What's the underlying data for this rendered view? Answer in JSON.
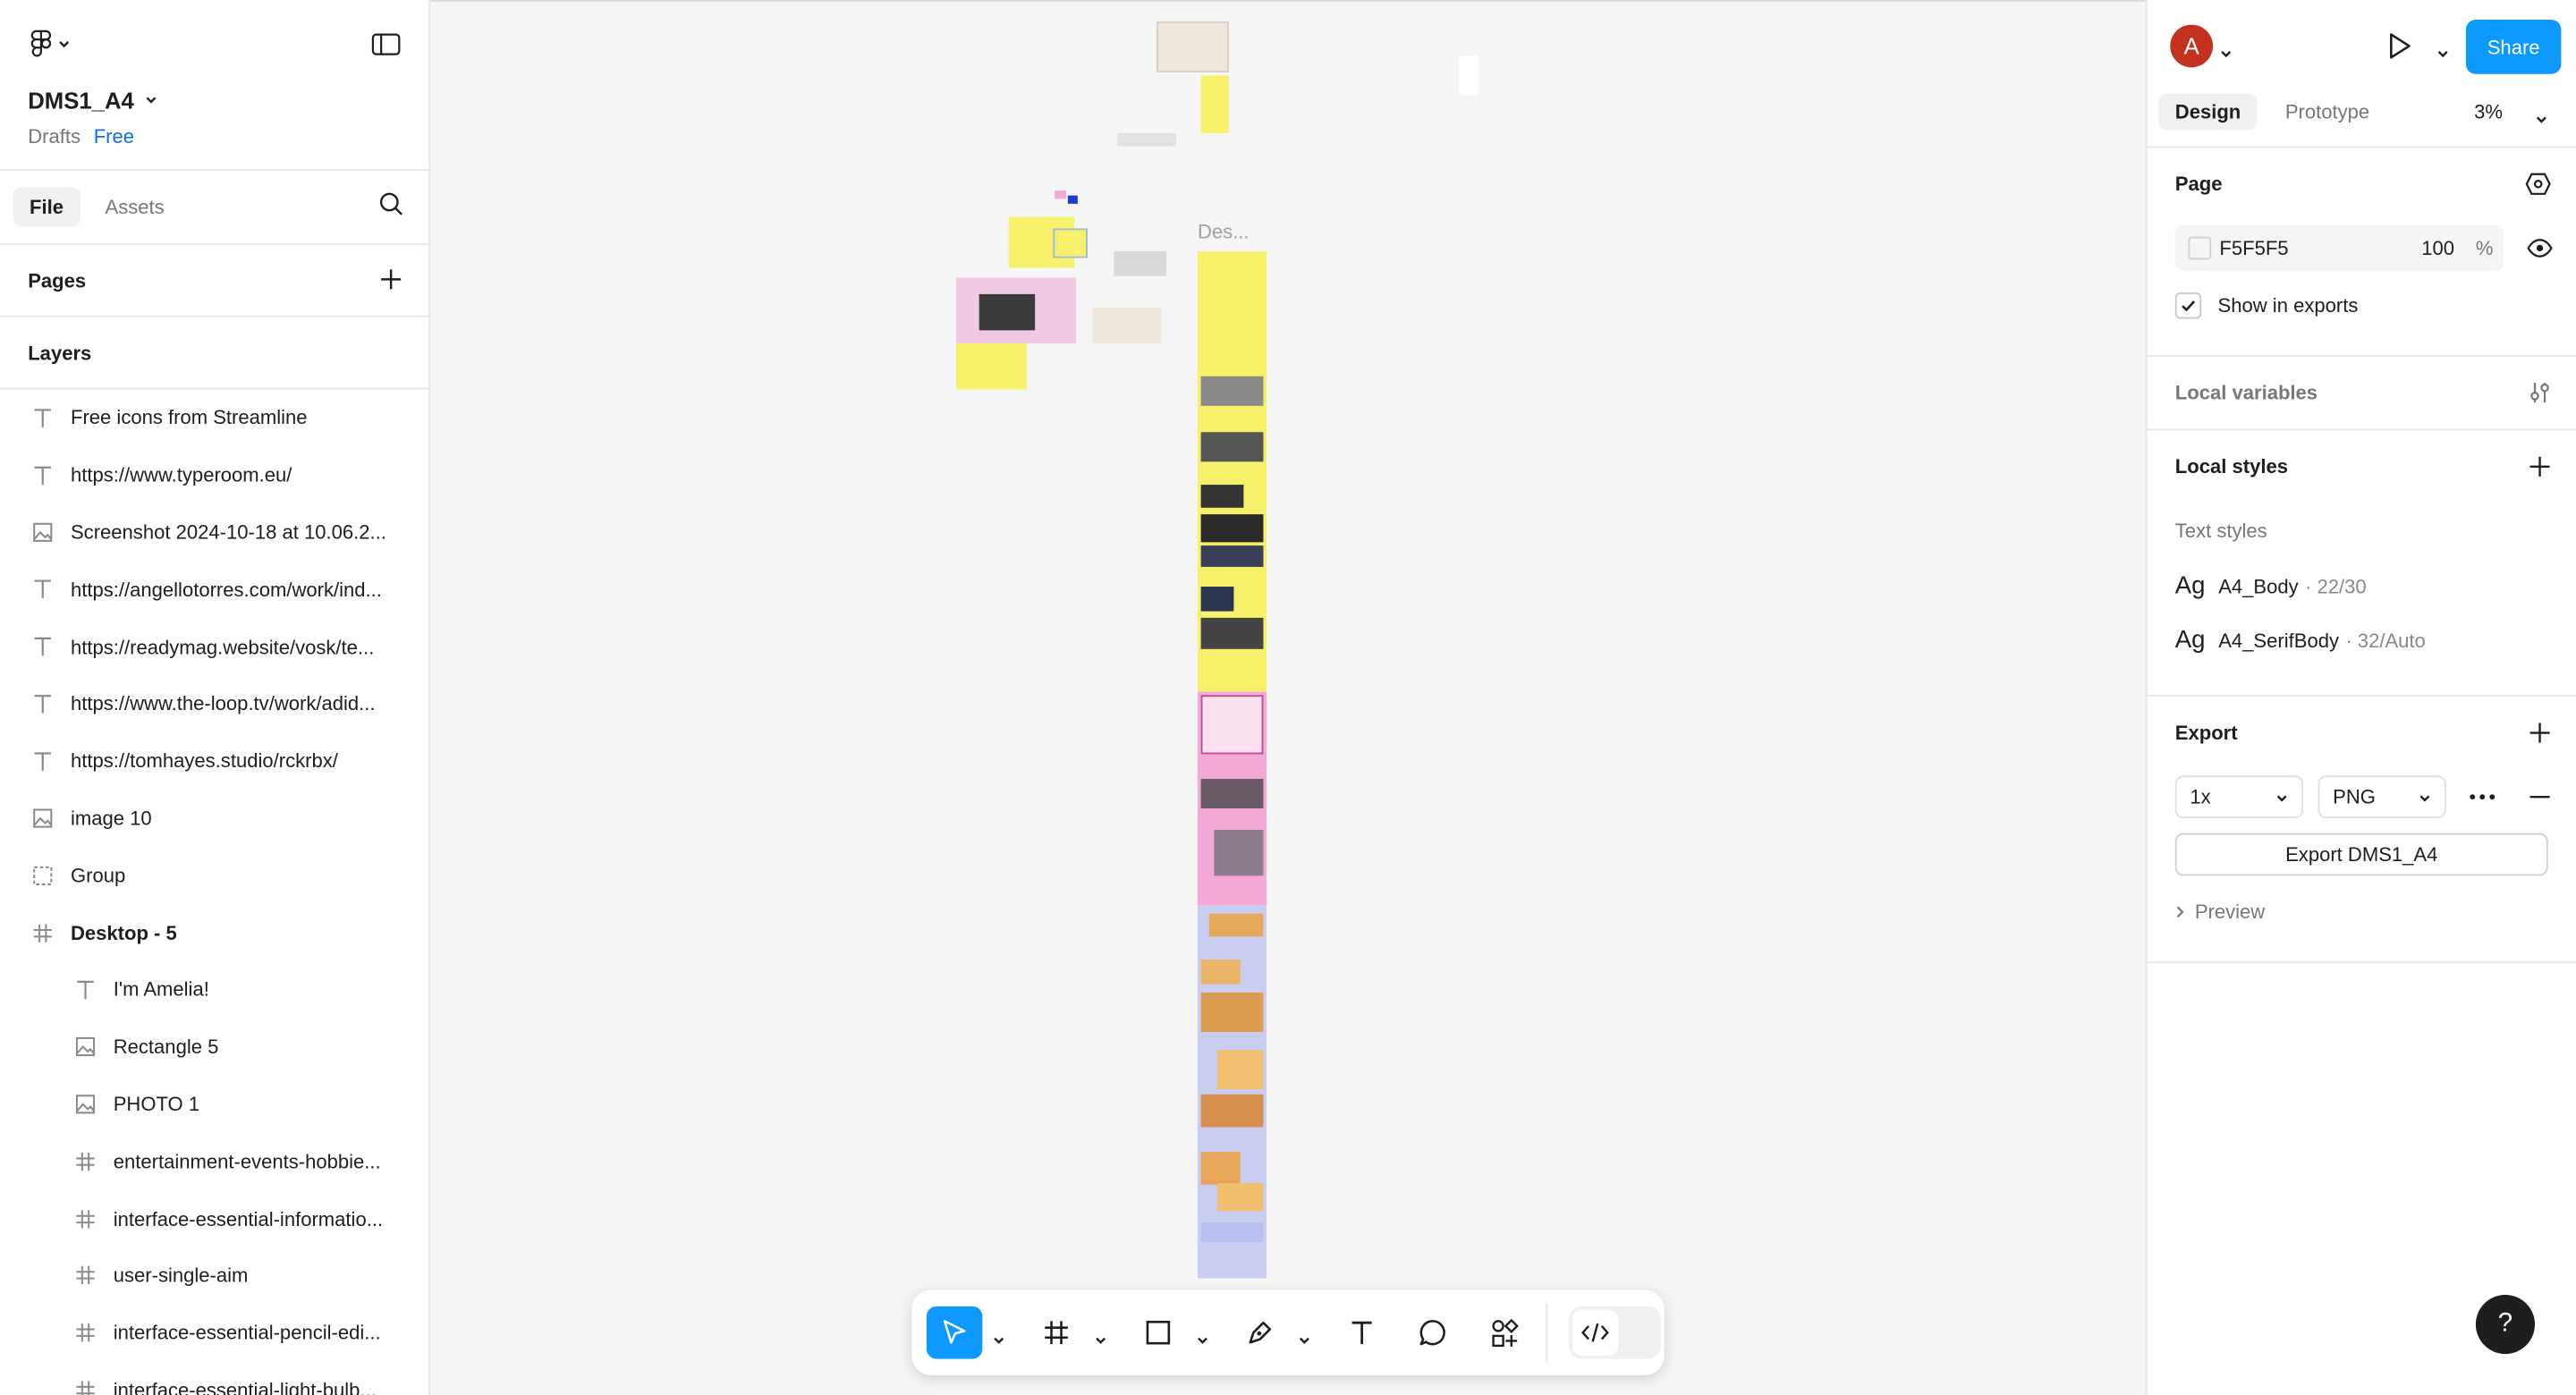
{
  "file": {
    "name": "DMS1_A4",
    "location": "Drafts",
    "plan": "Free"
  },
  "left_tabs": [
    "File",
    "Assets"
  ],
  "pages_label": "Pages",
  "layers_label": "Layers",
  "layers": [
    {
      "name": "Free icons from Streamline",
      "type": "text"
    },
    {
      "name": "https://www.typeroom.eu/",
      "type": "text"
    },
    {
      "name": "Screenshot 2024-10-18 at 10.06.2...",
      "type": "image"
    },
    {
      "name": "https://angellotorres.com/work/ind...",
      "type": "text"
    },
    {
      "name": "https://readymag.website/vosk/te...",
      "type": "text"
    },
    {
      "name": "https://www.the-loop.tv/work/adid...",
      "type": "text"
    },
    {
      "name": "https://tomhayes.studio/rckrbx/",
      "type": "text"
    },
    {
      "name": "image 10",
      "type": "image"
    },
    {
      "name": "Group",
      "type": "group"
    },
    {
      "name": "Desktop - 5",
      "type": "frame"
    },
    {
      "name": "I'm Amelia!",
      "type": "text"
    },
    {
      "name": "Rectangle 5",
      "type": "image"
    },
    {
      "name": "PHOTO 1",
      "type": "image"
    },
    {
      "name": "entertainment-events-hobbie...",
      "type": "frame"
    },
    {
      "name": "interface-essential-informatio...",
      "type": "frame"
    },
    {
      "name": "user-single-aim",
      "type": "frame"
    },
    {
      "name": "interface-essential-pencil-edi...",
      "type": "frame"
    },
    {
      "name": "interface-essential-light-bulb...",
      "type": "frame"
    }
  ],
  "canvas": {
    "frame_label": "Des...",
    "background": "#f5f5f5"
  },
  "right": {
    "avatar_initial": "A",
    "share_label": "Share",
    "tabs": [
      "Design",
      "Prototype"
    ],
    "zoom": "3%",
    "page_title": "Page",
    "page_color": "F5F5F5",
    "page_opacity": "100",
    "percent_sign": "%",
    "show_in_exports": "Show in exports",
    "local_variables": "Local variables",
    "local_styles": "Local styles",
    "text_styles_label": "Text styles",
    "text_styles": [
      {
        "ag": "Ag",
        "name": "A4_Body",
        "meta": "· 22/30"
      },
      {
        "ag": "Ag",
        "name": "A4_SerifBody",
        "meta": "· 32/Auto"
      }
    ],
    "export_title": "Export",
    "export_scale": "1x",
    "export_format": "PNG",
    "export_button": "Export DMS1_A4",
    "preview_label": "Preview",
    "help_label": "?"
  },
  "colors": {
    "accent": "#0d99ff",
    "yellow": "#f7f06a",
    "pink": "#f3a9d6",
    "lavender": "#c9cdf2",
    "avatar": "#c3321e"
  }
}
